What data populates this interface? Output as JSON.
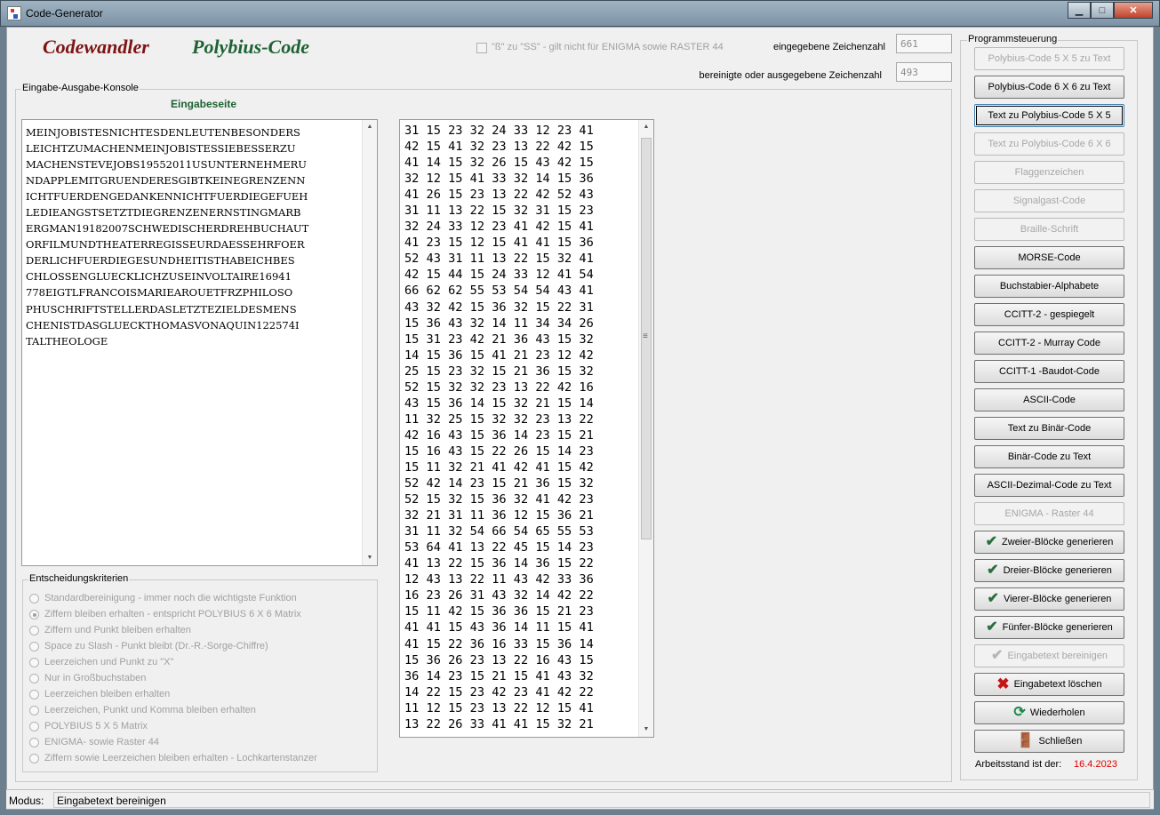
{
  "window": {
    "title": "Code-Generator",
    "min": "▁",
    "max": "□",
    "close": "✕"
  },
  "header": {
    "logo_left": "Codewandler",
    "logo_right": "Polybius-Code",
    "ss_option_label": "\"ß\" zu \"SS\" - gilt nicht für ENIGMA sowie RASTER 44",
    "input_count_label": "eingegebene Zeichenzahl",
    "input_count": "661",
    "output_count_label": "bereinigte oder ausgegebene Zeichenzahl",
    "output_count": "493"
  },
  "console": {
    "title": "Eingabe-Ausgabe-Konsole",
    "input_page_label": "Eingabeseite",
    "input_lines": [
      "MEINJOBISTESNICHTESDENLEUTENBESONDERS",
      "LEICHTZUMACHENMEINJOBISTESSIEBESSERZU",
      "MACHENSTEVEJOBS19552011USUNTERNEHMERU",
      "NDAPPLEMITGRUENDERESGIBTKEINEGRENZENN",
      "ICHTFUERDENGEDANKENNICHTFUERDIEGEFUEH",
      "LEDIEANGSTSETZTDIEGRENZENERNSTINGMARB",
      "ERGMAN19182007SCHWEDISCHERDREHBUCHAUT",
      "ORFILMUNDTHEATERREGISSEURDAESSEHRFOER",
      "DERLICHFUERDIEGESUNDHEITISTHABEICHBES",
      "CHLOSSENGLUECKLICHZUSEINVOLTAIRE16941",
      "778EIGTLFRANCOISMARIEAROUETFRZPHILOSO",
      "PHUSCHRIFTSTELLERDASLETZTEZIELDESMENS",
      "CHENISTDASGLUECKTHOMASVONAQUIN122574I",
      "TALTHEOLOGE"
    ],
    "output_lines": [
      "31 15 23 32 24 33 12 23 41",
      "42 15 41 32 23 13 22 42 15",
      "41 14 15 32 26 15 43 42 15",
      "32 12 15 41 33 32 14 15 36",
      "41 26 15 23 13 22 42 52 43",
      "31 11 13 22 15 32 31 15 23",
      "32 24 33 12 23 41 42 15 41",
      "41 23 15 12 15 41 41 15 36",
      "52 43 31 11 13 22 15 32 41",
      "42 15 44 15 24 33 12 41 54",
      "66 62 62 55 53 54 54 43 41",
      "43 32 42 15 36 32 15 22 31",
      "15 36 43 32 14 11 34 34 26",
      "15 31 23 42 21 36 43 15 32",
      "14 15 36 15 41 21 23 12 42",
      "25 15 23 32 15 21 36 15 32",
      "52 15 32 32 23 13 22 42 16",
      "43 15 36 14 15 32 21 15 14",
      "11 32 25 15 32 32 23 13 22",
      "42 16 43 15 36 14 23 15 21",
      "15 16 43 15 22 26 15 14 23",
      "15 11 32 21 41 42 41 15 42",
      "52 42 14 23 15 21 36 15 32",
      "52 15 32 15 36 32 41 42 23",
      "32 21 31 11 36 12 15 36 21",
      "31 11 32 54 66 54 65 55 53",
      "53 64 41 13 22 45 15 14 23",
      "41 13 22 15 36 14 36 15 22",
      "12 43 13 22 11 43 42 33 36",
      "16 23 26 31 43 32 14 42 22",
      "15 11 42 15 36 36 15 21 23",
      "41 41 15 43 36 14 11 15 41",
      "41 15 22 36 16 33 15 36 14",
      "15 36 26 23 13 22 16 43 15",
      "36 14 23 15 21 15 41 43 32",
      "14 22 15 23 42 23 41 42 22",
      "11 12 15 23 13 22 12 15 41",
      "13 22 26 33 41 41 15 32 21"
    ]
  },
  "criteria": {
    "title": "Entscheidungskriterien",
    "options": [
      {
        "label": "Standardbereinigung - immer noch die wichtigste Funktion",
        "selected": false
      },
      {
        "label": "Ziffern bleiben erhalten - entspricht POLYBIUS 6 X 6 Matrix",
        "selected": true
      },
      {
        "label": "Ziffern und Punkt bleiben erhalten",
        "selected": false
      },
      {
        "label": "Space zu Slash - Punkt bleibt  (Dr.-R.-Sorge-Chiffre)",
        "selected": false
      },
      {
        "label": "Leerzeichen und Punkt zu \"X\"",
        "selected": false
      },
      {
        "label": "Nur in Großbuchstaben",
        "selected": false
      },
      {
        "label": "Leerzeichen bleiben erhalten",
        "selected": false
      },
      {
        "label": "Leerzeichen, Punkt und Komma bleiben erhalten",
        "selected": false
      },
      {
        "label": "POLYBIUS 5 X 5 Matrix",
        "selected": false
      },
      {
        "label": "ENIGMA- sowie Raster 44",
        "selected": false
      },
      {
        "label": "Ziffern sowie Leerzeichen bleiben erhalten - Lochkartenstanzer",
        "selected": false
      }
    ]
  },
  "control": {
    "title": "Programmsteuerung",
    "buttons": [
      {
        "label": "Polybius-Code 5 X 5  zu Text",
        "state": "disabled",
        "icon": ""
      },
      {
        "label": "Polybius-Code 6 X 6  zu Text",
        "state": "normal",
        "icon": ""
      },
      {
        "label": "Text zu Polybius-Code 5 X 5",
        "state": "active",
        "icon": ""
      },
      {
        "label": "Text zu Polybius-Code 6  X 6",
        "state": "disabled",
        "icon": ""
      },
      {
        "label": "Flaggenzeichen",
        "state": "disabled",
        "icon": ""
      },
      {
        "label": "Signalgast-Code",
        "state": "disabled",
        "icon": ""
      },
      {
        "label": "Braille-Schrift",
        "state": "disabled",
        "icon": ""
      },
      {
        "label": "MORSE-Code",
        "state": "normal",
        "icon": ""
      },
      {
        "label": "Buchstabier-Alphabete",
        "state": "normal",
        "icon": ""
      },
      {
        "label": "CCITT-2 - gespiegelt",
        "state": "normal",
        "icon": ""
      },
      {
        "label": "CCITT-2 - Murray Code",
        "state": "normal",
        "icon": ""
      },
      {
        "label": "CCITT-1  -Baudot-Code",
        "state": "normal",
        "icon": ""
      },
      {
        "label": "ASCII-Code",
        "state": "normal",
        "icon": ""
      },
      {
        "label": "Text zu Binär-Code",
        "state": "normal",
        "icon": ""
      },
      {
        "label": "Binär-Code zu Text",
        "state": "normal",
        "icon": ""
      },
      {
        "label": "ASCII-Dezimal-Code zu Text",
        "state": "normal",
        "icon": ""
      },
      {
        "label": "ENIGMA - Raster 44",
        "state": "disabled",
        "icon": ""
      },
      {
        "label": "Zweier-Blöcke generieren",
        "state": "normal",
        "icon": "check"
      },
      {
        "label": "Dreier-Blöcke generieren",
        "state": "normal",
        "icon": "check"
      },
      {
        "label": "Vierer-Blöcke generieren",
        "state": "normal",
        "icon": "check"
      },
      {
        "label": "Fünfer-Blöcke generieren",
        "state": "normal",
        "icon": "check"
      },
      {
        "label": "Eingabetext bereinigen",
        "state": "disabled",
        "icon": "check"
      },
      {
        "label": "Eingabetext löschen",
        "state": "normal",
        "icon": "x"
      },
      {
        "label": "Wiederholen",
        "state": "normal",
        "icon": "redo"
      },
      {
        "label": "Schließen",
        "state": "normal",
        "icon": "door"
      }
    ],
    "version_label": "Arbeitsstand ist der:",
    "version_date": "16.4.2023"
  },
  "icons": {
    "check": "✔",
    "x": "✖",
    "redo": "⟳",
    "door": "🚪"
  },
  "status": {
    "label": "Modus:",
    "value": "Eingabetext bereinigen"
  }
}
